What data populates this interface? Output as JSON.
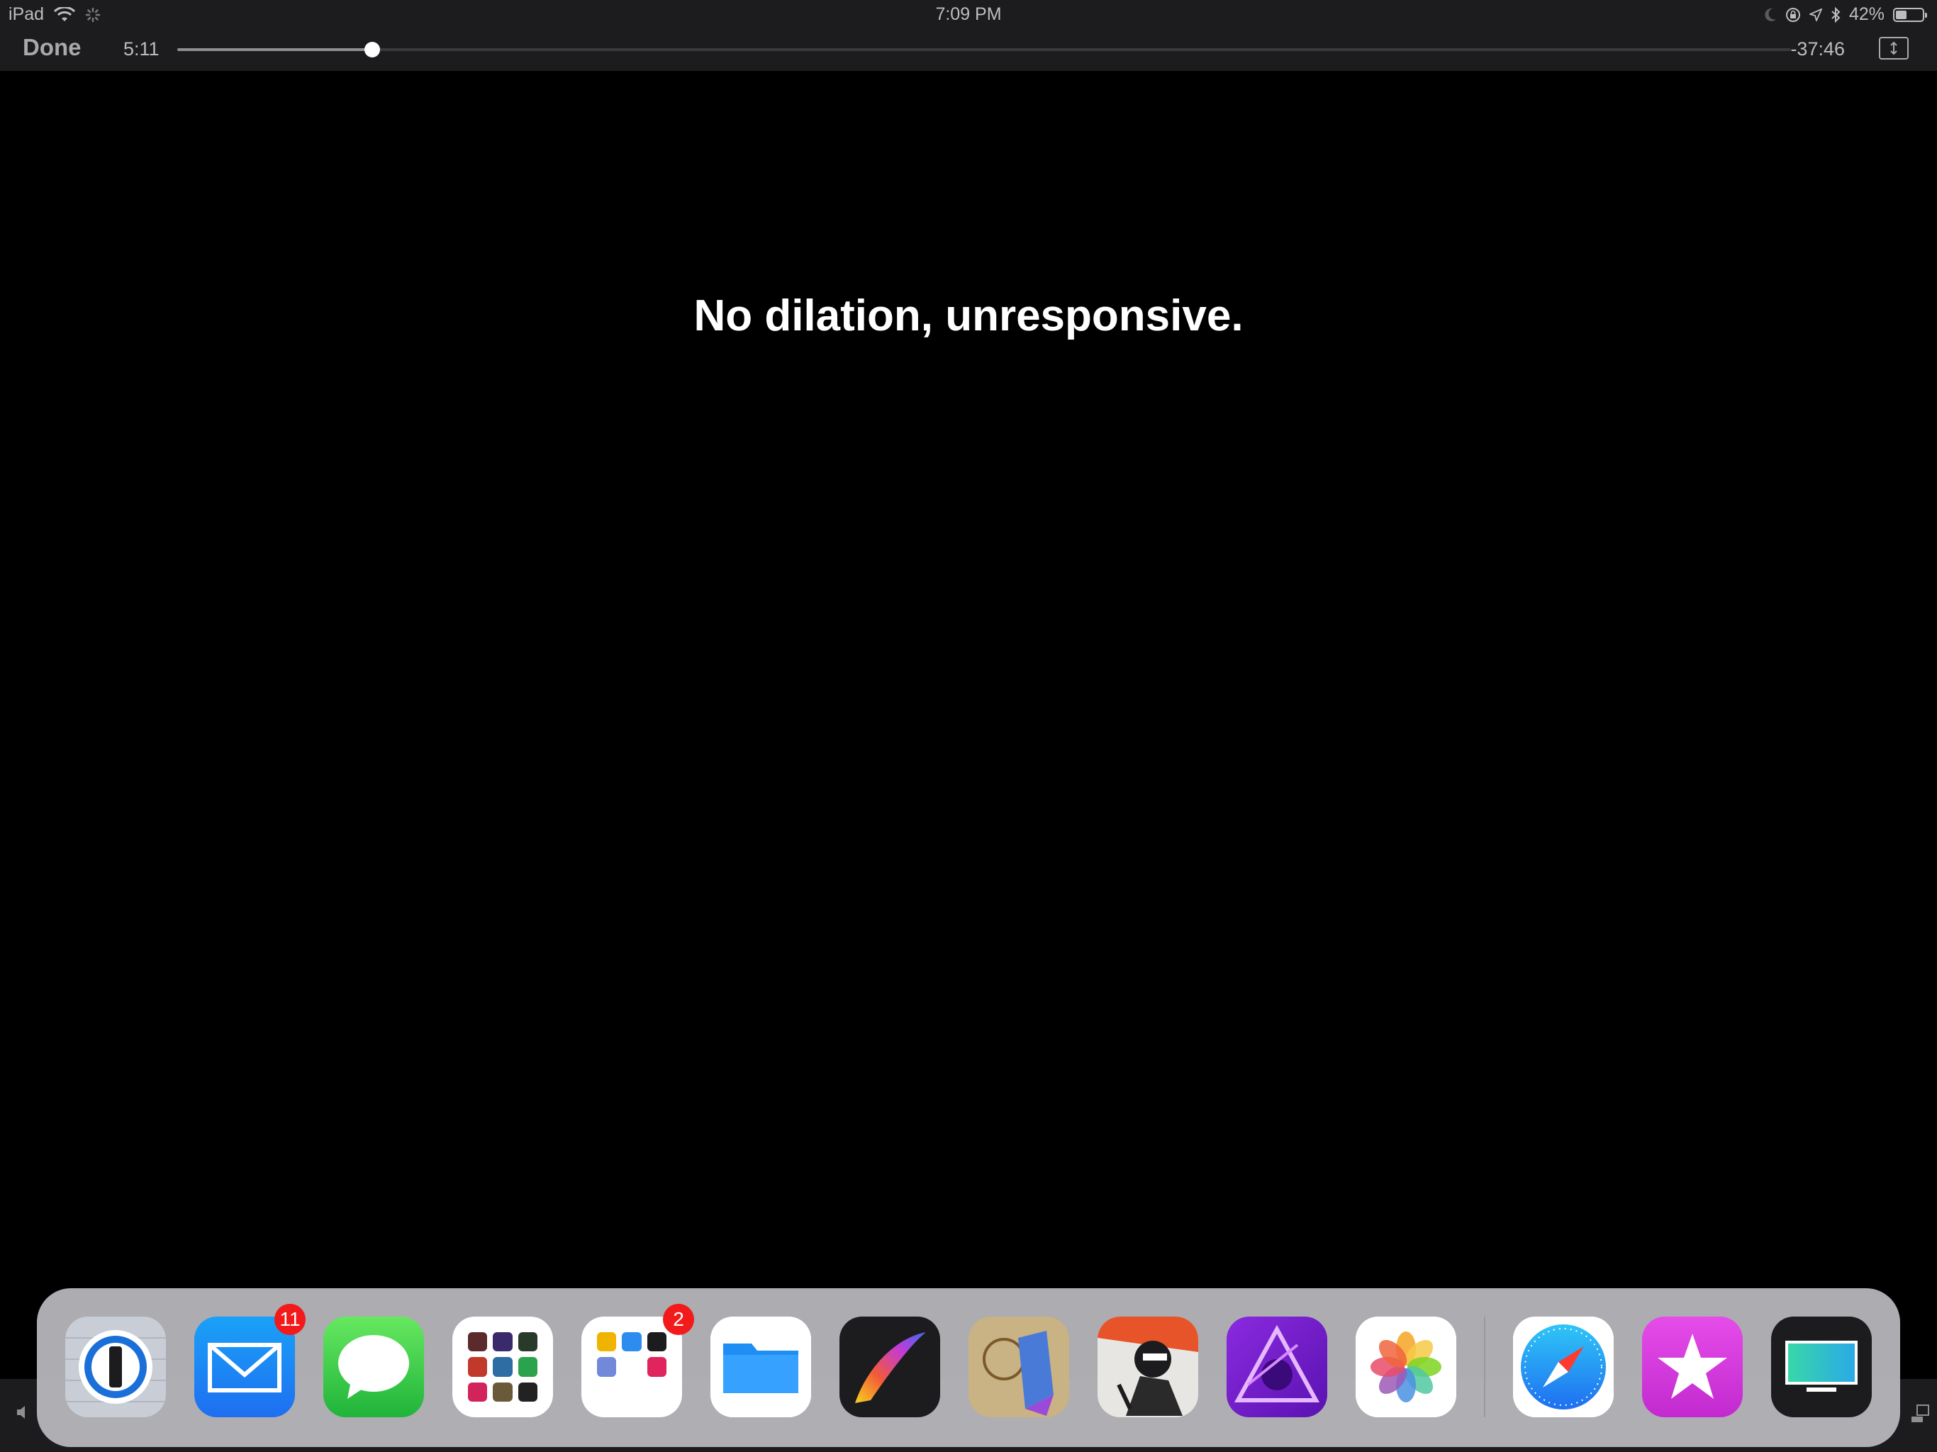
{
  "status_bar": {
    "device": "iPad",
    "time": "7:09 PM",
    "battery": "42%",
    "battery_level": 0.42,
    "icons": [
      "wifi-icon",
      "activity-icon",
      "moon-icon",
      "orientation-lock-icon",
      "location-icon",
      "bluetooth-icon",
      "battery-icon"
    ]
  },
  "player": {
    "done_label": "Done",
    "elapsed": "5:11",
    "remaining": "-37:46",
    "progress": 0.121
  },
  "subtitle": "No dilation, unresponsive.",
  "dock": {
    "background": "#b9b9be",
    "apps": [
      {
        "name": "1password-icon",
        "badge": ""
      },
      {
        "name": "mail-icon",
        "badge": "11"
      },
      {
        "name": "messages-icon",
        "badge": ""
      },
      {
        "name": "app-folder-icon",
        "badge": ""
      },
      {
        "name": "app-folder-2-icon",
        "badge": "2"
      },
      {
        "name": "files-icon",
        "badge": ""
      },
      {
        "name": "procreate-icon",
        "badge": ""
      },
      {
        "name": "sketch-app-icon",
        "badge": ""
      },
      {
        "name": "drawing-app-icon",
        "badge": ""
      },
      {
        "name": "affinity-photo-icon",
        "badge": ""
      },
      {
        "name": "photos-icon",
        "badge": ""
      },
      {
        "name": "safari-icon",
        "badge": ""
      },
      {
        "name": "itunes-store-icon",
        "badge": ""
      },
      {
        "name": "screen-mirror-icon",
        "badge": ""
      }
    ]
  },
  "colors": {
    "badge": "#f21a1a",
    "toolbar": "#1c1c1e",
    "mail_blue": "#1e8df4",
    "messages_green": "#34c84a",
    "itunes_pink": "#d63fd6"
  }
}
